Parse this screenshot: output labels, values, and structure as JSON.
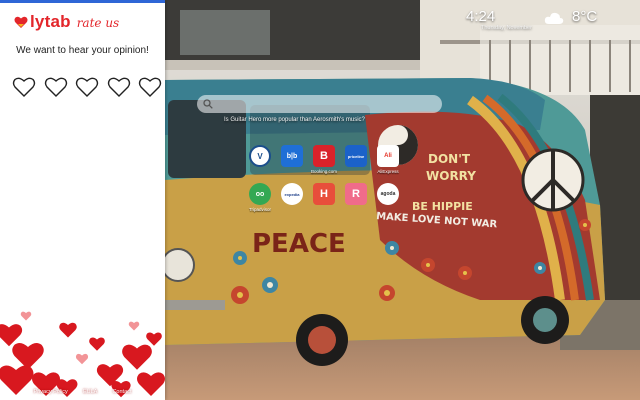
{
  "brand": {
    "name": "lytab",
    "tagline": "rate us",
    "accent": "#e3262b",
    "top_bar_color": "#2f66d6"
  },
  "rating": {
    "prompt": "We want to hear your opinion!",
    "max": 5,
    "icon": "heart-outline-icon"
  },
  "footer": {
    "links": [
      "Privacy Policy",
      "EULA",
      "Contact"
    ]
  },
  "clock": {
    "time": "4:24",
    "date": "Thursday, November"
  },
  "weather": {
    "icon": "cloud-icon",
    "temp": "8°C",
    "location": ""
  },
  "search": {
    "value": "",
    "placeholder": ""
  },
  "trivia": "Is Guitar Hero more popular than Aerosmith's music?",
  "shortcuts": [
    {
      "label": "",
      "icon": "circle-v-icon",
      "color": "#ffffff",
      "text": "V"
    },
    {
      "label": "",
      "icon": "bb-icon",
      "color": "#1f6fd6",
      "text": "b|b"
    },
    {
      "label": "Booking.com",
      "icon": "b-icon",
      "color": "#d9222a",
      "text": "B"
    },
    {
      "label": "",
      "icon": "priceline-icon",
      "color": "#1b62c9",
      "text": "priceline"
    },
    {
      "label": "AliExpress",
      "icon": "aliexpress-icon",
      "color": "#ffffff",
      "text": "Ali"
    },
    {
      "label": "Tripadvisor",
      "icon": "owl-icon",
      "color": "#34a853",
      "text": "oo"
    },
    {
      "label": "",
      "icon": "expedia-icon",
      "color": "#ffffff",
      "text": "expedia"
    },
    {
      "label": "",
      "icon": "h-icon",
      "color": "#e84e3b",
      "text": "H"
    },
    {
      "label": "",
      "icon": "r-icon",
      "color": "#f06b8a",
      "text": "R"
    },
    {
      "label": "",
      "icon": "agoda-icon",
      "color": "#ffffff",
      "text": "agoda"
    }
  ],
  "scene_colors": {
    "van_yellow": "#c9a047",
    "van_teal": "#4f9a97",
    "van_red": "#a33a2f",
    "sky": "#d9d6cf",
    "ground": "#b08062"
  },
  "van_text": {
    "side": "PEACE",
    "back_1": "DON'T",
    "back_2": "WORRY",
    "back_3": "BE HIPPIE",
    "back_4": "MAKE LOVE NOT WAR"
  }
}
